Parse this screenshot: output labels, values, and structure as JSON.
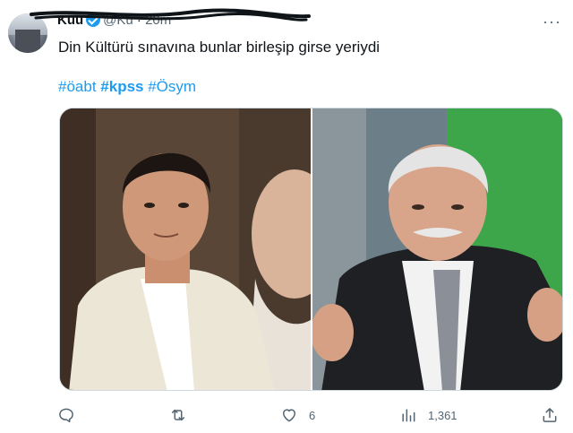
{
  "tweet": {
    "author_name": "Kuu",
    "author_handle": "@Ku",
    "time": "20m",
    "more_label": "···",
    "text": "Din Kültürü sınavına bunlar birleşip girse yeriydi",
    "hashtags": [
      {
        "label": "#öabt",
        "bold": false
      },
      {
        "label": "#kpss",
        "bold": true
      },
      {
        "label": "#Ösym",
        "bold": false
      }
    ]
  },
  "media": {
    "left_image": "photo-man-white-jacket",
    "right_image": "photo-man-dark-suit-gesturing"
  },
  "actions": {
    "reply": {
      "icon": "reply-icon",
      "count": ""
    },
    "retweet": {
      "icon": "retweet-icon",
      "count": ""
    },
    "like": {
      "icon": "heart-icon",
      "count": "6"
    },
    "views": {
      "icon": "views-icon",
      "count": "1,361"
    },
    "share": {
      "icon": "share-icon",
      "count": ""
    }
  },
  "colors": {
    "link": "#1d9bf0",
    "muted": "#536471",
    "text": "#0f1419"
  }
}
